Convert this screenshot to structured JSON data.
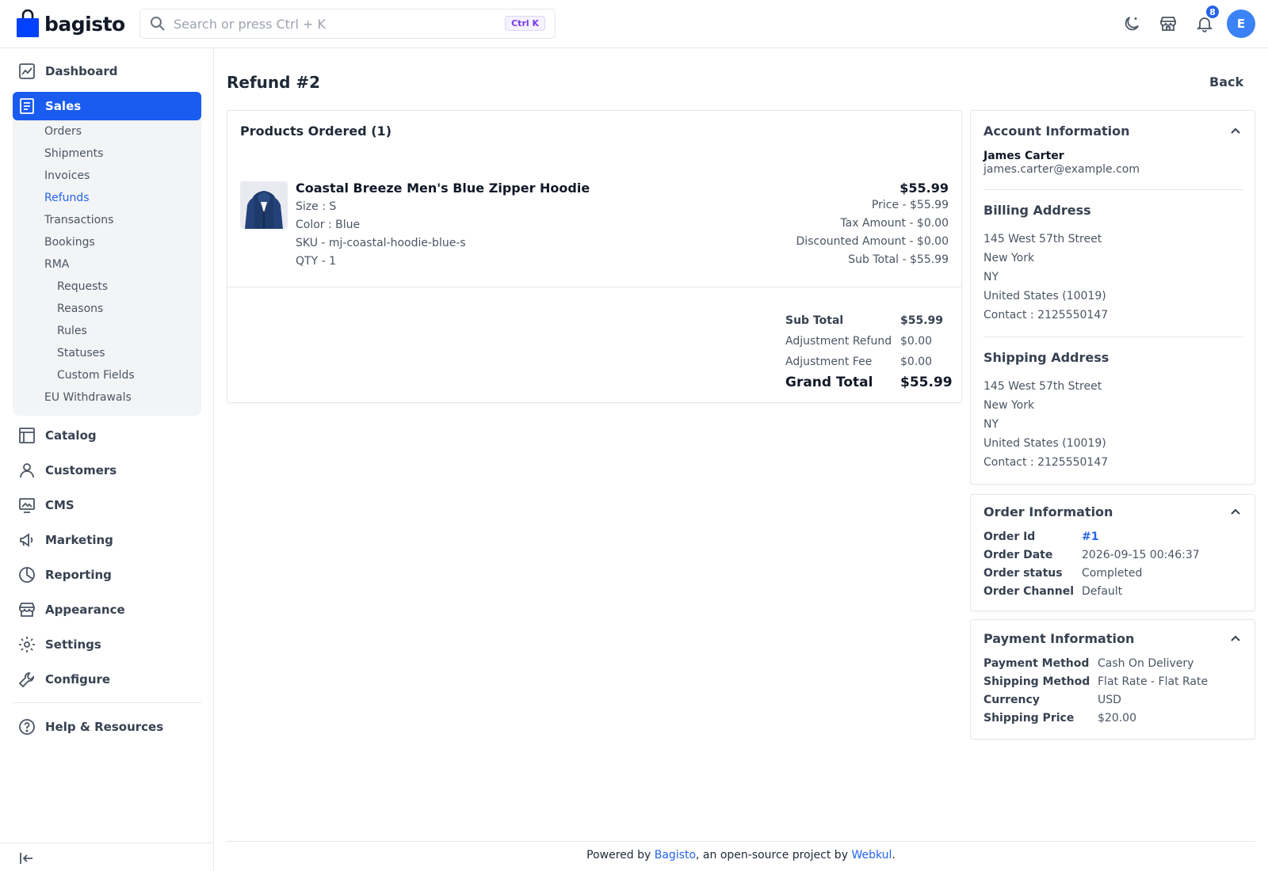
{
  "header": {
    "logo_text": "bagisto",
    "search_placeholder": "Search or press Ctrl + K",
    "search_shortcut": "Ctrl K",
    "notification_count": "8",
    "avatar_initial": "E"
  },
  "sidebar": {
    "items": [
      {
        "label": "Dashboard",
        "icon": "dashboard-icon"
      },
      {
        "label": "Sales",
        "icon": "sales-icon",
        "active": true
      },
      {
        "label": "Catalog",
        "icon": "catalog-icon"
      },
      {
        "label": "Customers",
        "icon": "customers-icon"
      },
      {
        "label": "CMS",
        "icon": "cms-icon"
      },
      {
        "label": "Marketing",
        "icon": "marketing-icon"
      },
      {
        "label": "Reporting",
        "icon": "reporting-icon"
      },
      {
        "label": "Appearance",
        "icon": "appearance-icon"
      },
      {
        "label": "Settings",
        "icon": "settings-icon"
      },
      {
        "label": "Configure",
        "icon": "configure-icon"
      }
    ],
    "sales_submenu": [
      "Orders",
      "Shipments",
      "Invoices",
      "Refunds",
      "Transactions",
      "Bookings",
      "RMA"
    ],
    "rma_submenu": [
      "Requests",
      "Reasons",
      "Rules",
      "Statuses",
      "Custom Fields"
    ],
    "eu_withdrawals": "EU Withdrawals",
    "help": "Help & Resources",
    "accent_color": "#1a5cf0"
  },
  "page": {
    "title": "Refund #2",
    "back_label": "Back"
  },
  "products": {
    "title": "Products Ordered (1)",
    "item": {
      "name": "Coastal Breeze Men's Blue Zipper Hoodie",
      "size": "Size : S",
      "color": "Color : Blue",
      "sku": "SKU - mj-coastal-hoodie-blue-s",
      "qty": "QTY - 1",
      "total": "$55.99",
      "price": "Price - $55.99",
      "tax": "Tax Amount - $0.00",
      "discount": "Discounted Amount - $0.00",
      "subtotal": "Sub Total - $55.99"
    },
    "totals": {
      "sub_total_label": "Sub Total",
      "sub_total": "$55.99",
      "adjustment_refund_label": "Adjustment Refund",
      "adjustment_refund": "$0.00",
      "adjustment_fee_label": "Adjustment Fee",
      "adjustment_fee": "$0.00",
      "grand_total_label": "Grand Total",
      "grand_total": "$55.99"
    }
  },
  "account": {
    "title": "Account Information",
    "name": "James Carter",
    "email": "james.carter@example.com",
    "billing_title": "Billing Address",
    "billing": [
      "145 West 57th Street",
      "New York",
      "NY",
      "United States (10019)",
      "Contact : 2125550147"
    ],
    "shipping_title": "Shipping Address",
    "shipping": [
      "145 West 57th Street",
      "New York",
      "NY",
      "United States (10019)",
      "Contact : 2125550147"
    ]
  },
  "order": {
    "title": "Order Information",
    "id_label": "Order Id",
    "id": "#1",
    "date_label": "Order Date",
    "date": "2026-09-15 00:46:37",
    "status_label": "Order status",
    "status": "Completed",
    "channel_label": "Order Channel",
    "channel": "Default"
  },
  "payment": {
    "title": "Payment Information",
    "method_label": "Payment Method",
    "method": "Cash On Delivery",
    "shipping_method_label": "Shipping Method",
    "shipping_method": "Flat Rate - Flat Rate",
    "currency_label": "Currency",
    "currency": "USD",
    "shipping_price_label": "Shipping Price",
    "shipping_price": "$20.00"
  },
  "footer": {
    "prefix": "Powered by ",
    "bagisto": "Bagisto",
    "middle": ", an open-source project by ",
    "webkul": "Webkul",
    "suffix": "."
  }
}
